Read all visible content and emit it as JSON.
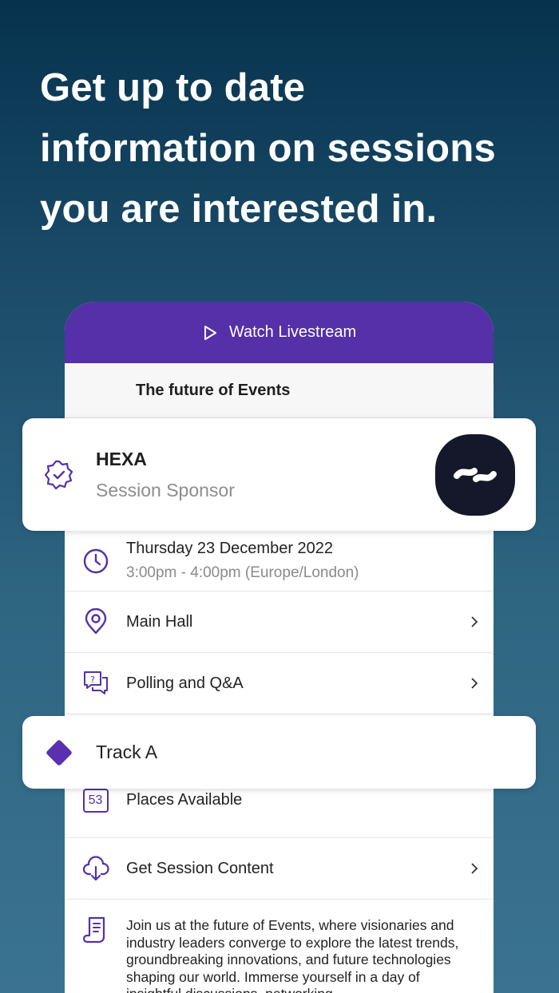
{
  "headline": {
    "line1": "Get up to date",
    "line2": "information on sessions",
    "line3": "you are interested in."
  },
  "card": {
    "livestream_label": "Watch Livestream",
    "session_title": "The future of Events",
    "date": "Thursday 23 December 2022",
    "time": "3:00pm - 4:00pm (Europe/London)",
    "location": "Main Hall",
    "polling": "Polling and Q&A",
    "places_count": "53",
    "places_label": "Places Available",
    "content_label": "Get Session Content",
    "description": "Join us at the future of Events, where visionaries and industry leaders converge to explore the latest trends, groundbreaking innovations, and future technologies shaping our world. Immerse yourself in a day of insightful discussions, networking"
  },
  "sponsor": {
    "name": "HEXA",
    "role": "Session Sponsor"
  },
  "track": {
    "label": "Track A"
  },
  "colors": {
    "accent": "#5530a9",
    "logo_bg": "#15182b"
  }
}
